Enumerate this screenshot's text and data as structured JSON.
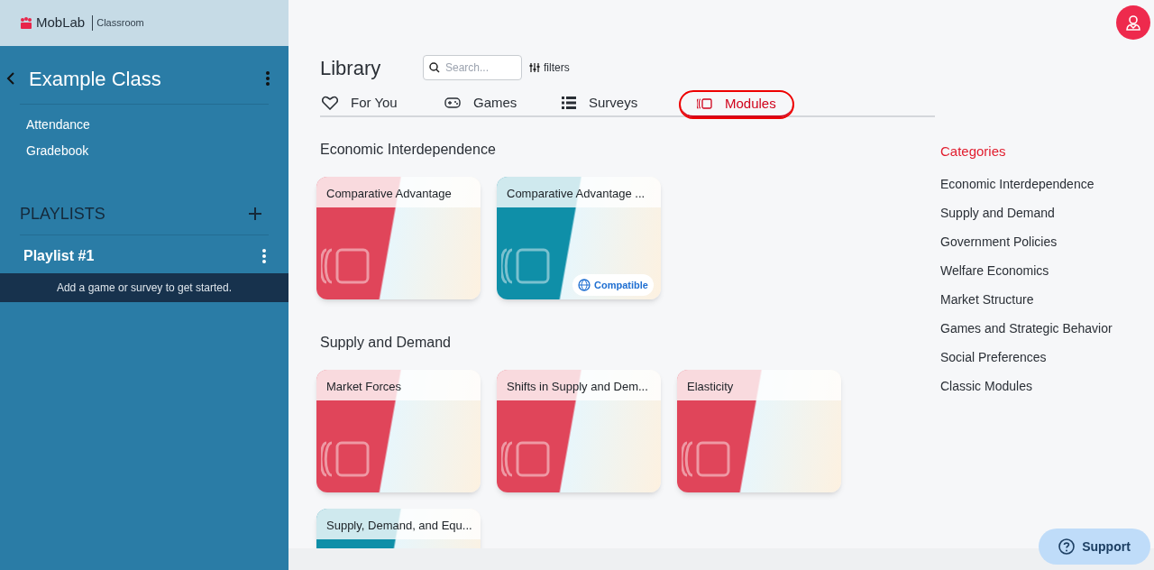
{
  "brand": {
    "name": "MobLab",
    "product": "Classroom"
  },
  "sidebar": {
    "class_title": "Example Class",
    "links": [
      "Attendance",
      "Gradebook"
    ],
    "playlists_heading": "PLAYLISTS",
    "playlists": [
      {
        "name": "Playlist #1",
        "empty_message": "Add a game or survey to get started."
      }
    ]
  },
  "library": {
    "title": "Library",
    "search": {
      "placeholder": "Search..."
    },
    "filters_label": "filters",
    "tabs": [
      {
        "label": "For You",
        "kind": "heart",
        "selected": false
      },
      {
        "label": "Games",
        "kind": "gamepad",
        "selected": false
      },
      {
        "label": "Surveys",
        "kind": "list",
        "selected": false
      },
      {
        "label": "Modules",
        "kind": "modules",
        "selected": true
      }
    ],
    "sections": [
      {
        "title": "Economic Interdependence",
        "cards": [
          {
            "title": "Comparative Advantage",
            "color": "#e0455a"
          },
          {
            "title": "Comparative Advantage ...",
            "color": "#0f8fa8",
            "badge": "Compatible"
          }
        ]
      },
      {
        "title": "Supply and Demand",
        "cards": [
          {
            "title": "Market Forces",
            "color": "#e0455a"
          },
          {
            "title": "Shifts in Supply and Dem...",
            "color": "#e0455a"
          },
          {
            "title": "Elasticity",
            "color": "#e0455a"
          },
          {
            "title": "Supply, Demand, and Equ...",
            "color": "#0f8fa8"
          }
        ]
      }
    ]
  },
  "categories": {
    "heading": "Categories",
    "items": [
      "Economic Interdependence",
      "Supply and Demand",
      "Government Policies",
      "Welfare Economics",
      "Market Structure",
      "Games and Strategic Behavior",
      "Social Preferences",
      "Classic Modules"
    ]
  },
  "support_button": "Support"
}
